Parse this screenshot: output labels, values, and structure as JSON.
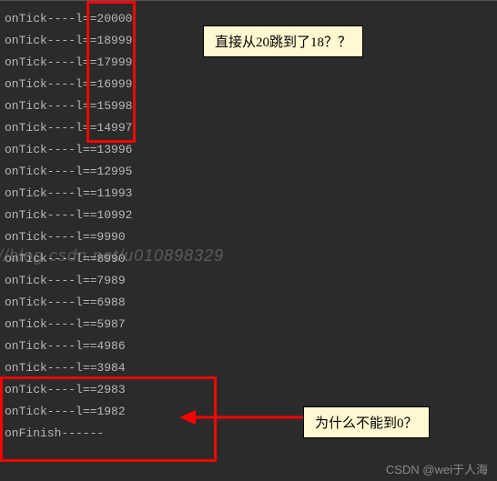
{
  "log_lines": [
    "onTick----l==20000",
    "onTick----l==18999",
    "onTick----l==17999",
    "onTick----l==16999",
    "onTick----l==15998",
    "onTick----l==14997",
    "onTick----l==13996",
    "onTick----l==12995",
    "onTick----l==11993",
    "onTick----l==10992",
    "onTick----l==9990",
    "onTick----l==8990",
    "onTick----l==7989",
    "onTick----l==6988",
    "onTick----l==5987",
    "onTick----l==4986",
    "onTick----l==3984",
    "onTick----l==2983",
    "onTick----l==1982",
    "onFinish------"
  ],
  "callouts": {
    "top": "直接从20跳到了18？？",
    "bottom": "为什么不能到0？"
  },
  "watermark": "//blog.csdn.net/u010898329",
  "footer": "CSDN @wei于人海",
  "colors": {
    "annotation": "#ff0000",
    "callout_bg": "#fff8d0",
    "console_bg": "#2b2b2b",
    "console_fg": "#b8b8b8"
  }
}
